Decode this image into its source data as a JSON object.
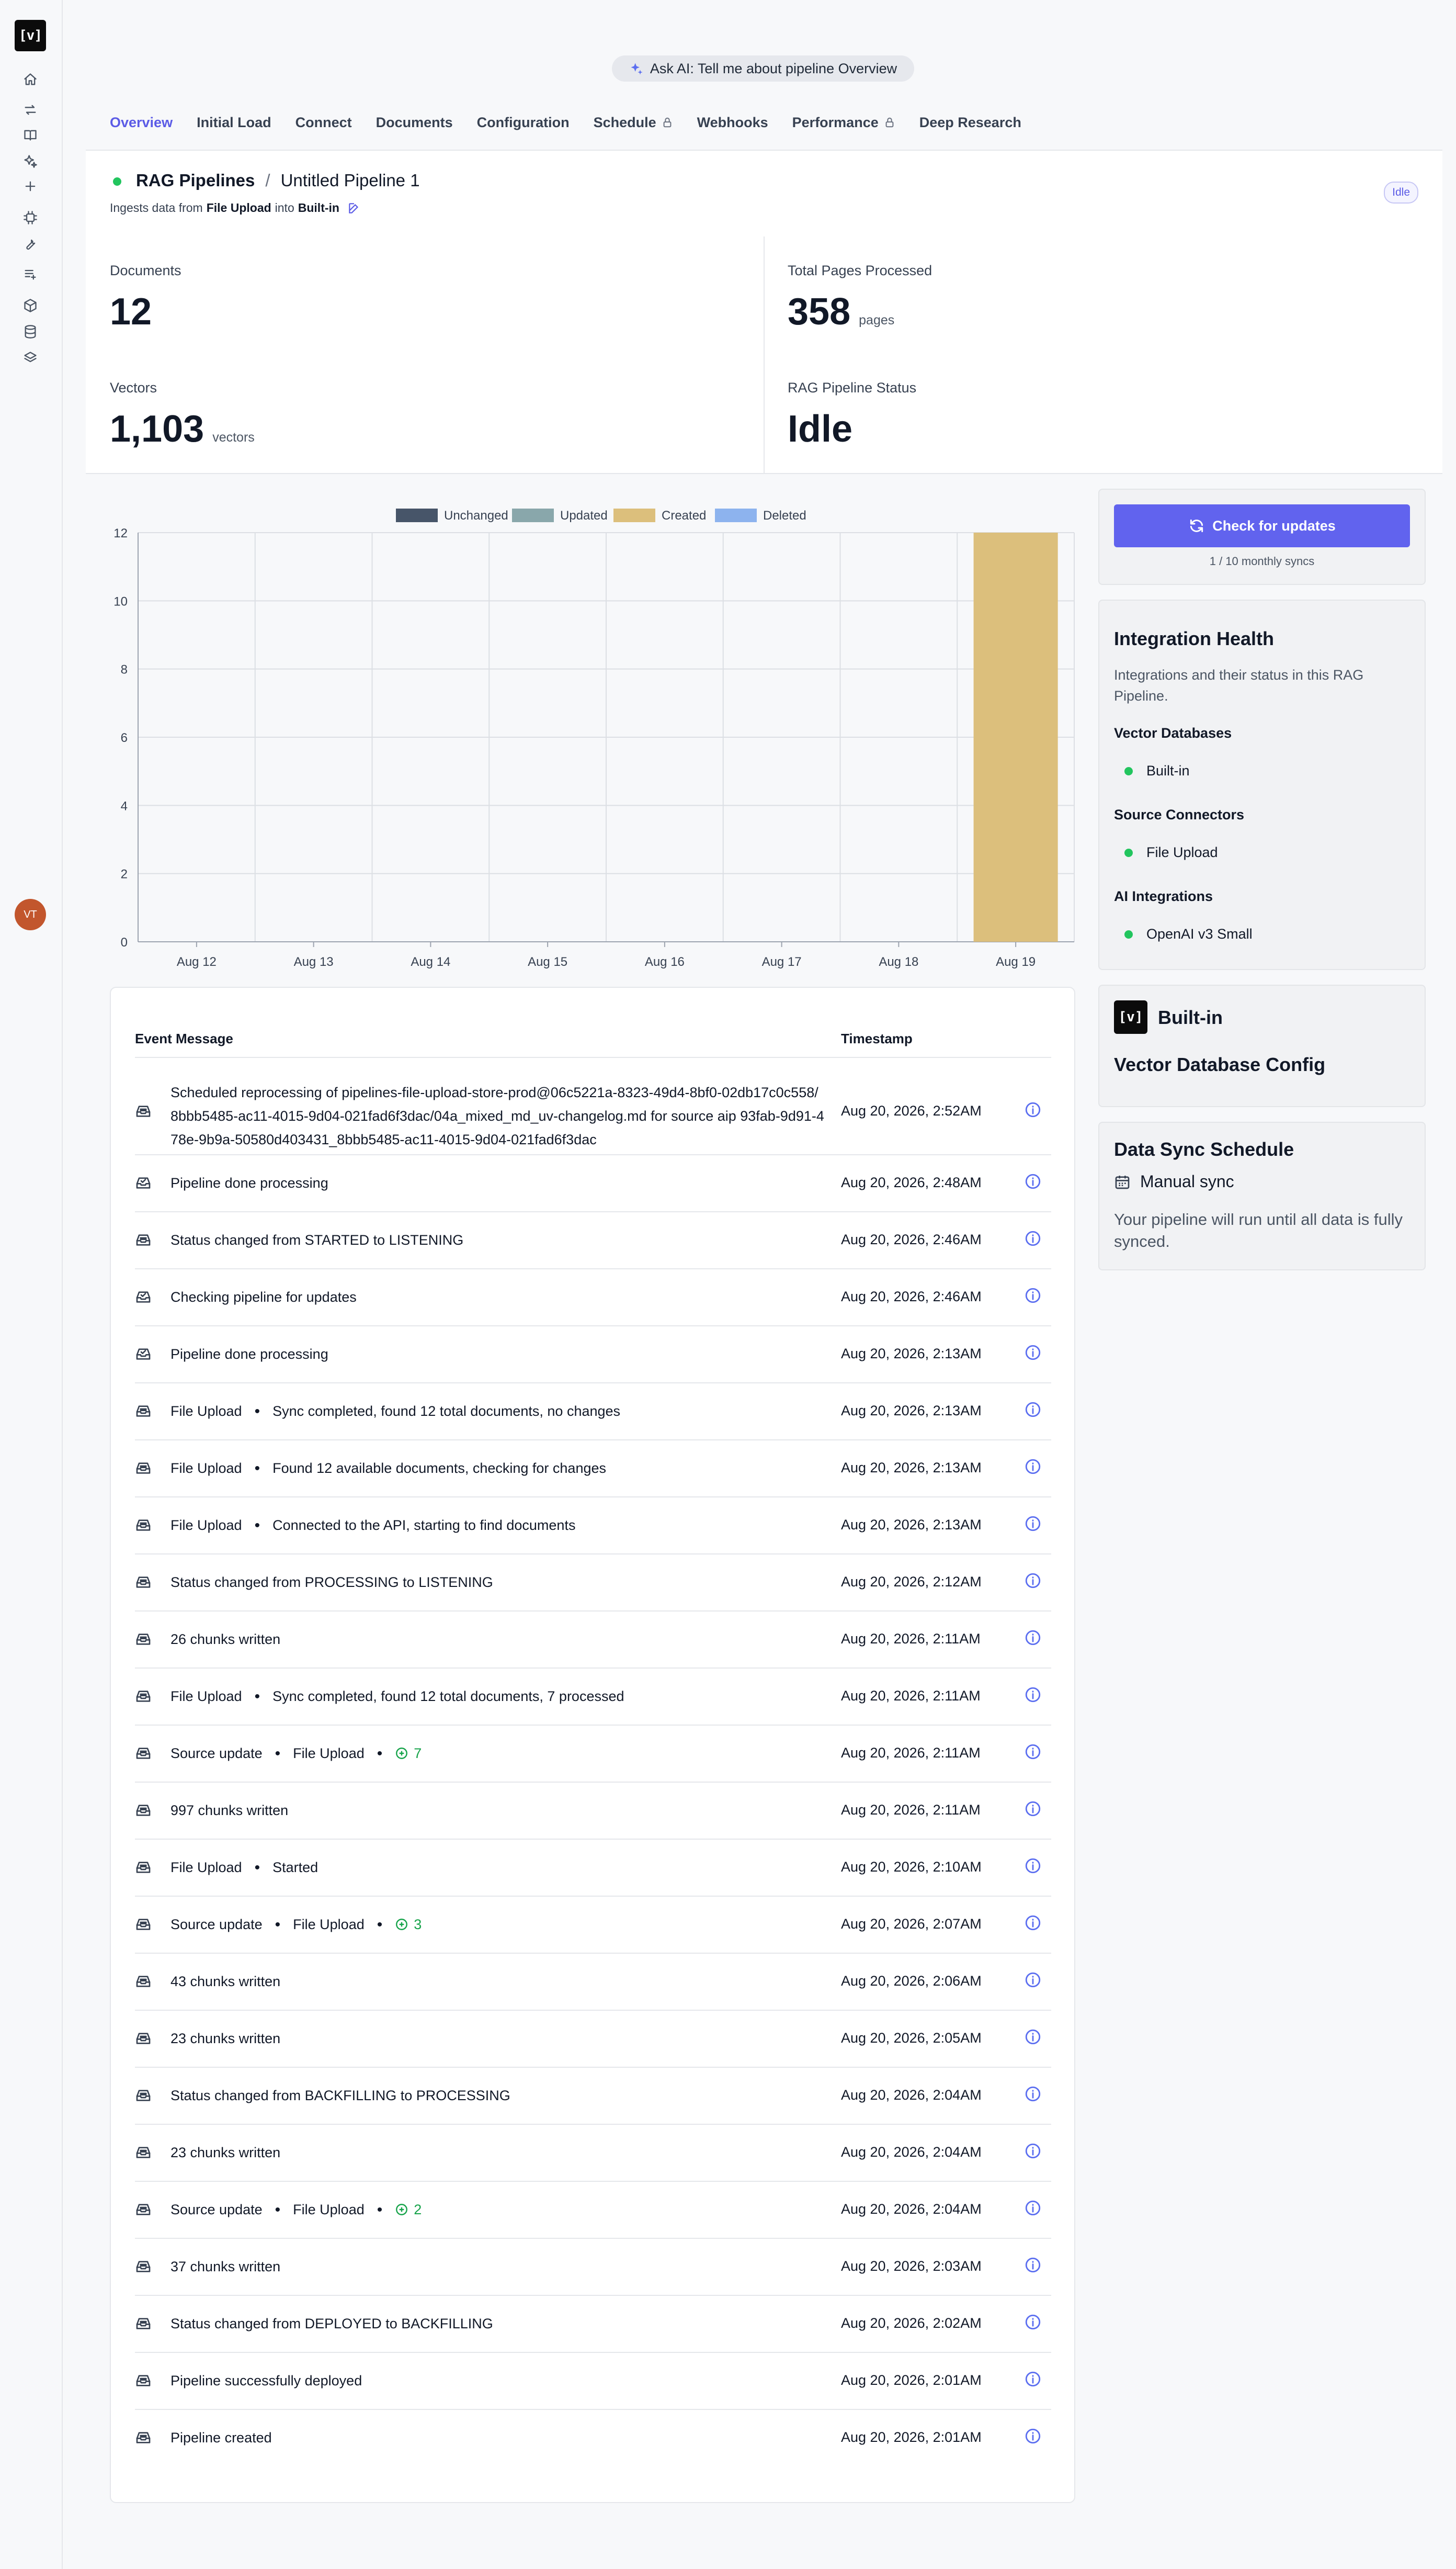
{
  "sidebar": {
    "logo": "[v]",
    "icons": [
      "home-icon",
      "sync-icon",
      "book-icon",
      "sparkles-icon",
      "plus-icon",
      "chip-icon",
      "wrench-icon",
      "list-icon",
      "cube-icon",
      "database-icon",
      "layers-icon"
    ],
    "avatar": "VT"
  },
  "ask_ai": {
    "label": "Ask AI: Tell me about pipeline Overview"
  },
  "tabs": [
    {
      "label": "Overview",
      "active": true,
      "locked": false
    },
    {
      "label": "Initial Load",
      "active": false,
      "locked": false
    },
    {
      "label": "Connect",
      "active": false,
      "locked": false
    },
    {
      "label": "Documents",
      "active": false,
      "locked": false
    },
    {
      "label": "Configuration",
      "active": false,
      "locked": false
    },
    {
      "label": "Schedule",
      "active": false,
      "locked": true
    },
    {
      "label": "Webhooks",
      "active": false,
      "locked": false
    },
    {
      "label": "Performance",
      "active": false,
      "locked": true
    },
    {
      "label": "Deep Research",
      "active": false,
      "locked": false
    }
  ],
  "header": {
    "breadcrumb_root": "RAG Pipelines",
    "separator": "/",
    "pipeline_name": "Untitled Pipeline 1",
    "ingest_prefix": "Ingests data from",
    "source": "File Upload",
    "ingest_middle": "into",
    "destination": "Built-in",
    "status_badge": "Idle"
  },
  "stats": {
    "documents": {
      "label": "Documents",
      "value": "12",
      "unit": ""
    },
    "pages": {
      "label": "Total Pages Processed",
      "value": "358",
      "unit": "pages"
    },
    "vectors": {
      "label": "Vectors",
      "value": "1,103",
      "unit": "vectors"
    },
    "status": {
      "label": "RAG Pipeline Status",
      "value": "Idle",
      "unit": ""
    }
  },
  "chart_data": {
    "type": "bar",
    "stacked": true,
    "categories": [
      "Aug 12",
      "Aug 13",
      "Aug 14",
      "Aug 15",
      "Aug 16",
      "Aug 17",
      "Aug 18",
      "Aug 19"
    ],
    "series": [
      {
        "name": "Unchanged",
        "color": "#475569",
        "values": [
          0,
          0,
          0,
          0,
          0,
          0,
          0,
          0
        ]
      },
      {
        "name": "Updated",
        "color": "#89a7ab",
        "values": [
          0,
          0,
          0,
          0,
          0,
          0,
          0,
          0
        ]
      },
      {
        "name": "Created",
        "color": "#dcbf7c",
        "values": [
          0,
          0,
          0,
          0,
          0,
          0,
          0,
          12
        ]
      },
      {
        "name": "Deleted",
        "color": "#8db3ee",
        "values": [
          0,
          0,
          0,
          0,
          0,
          0,
          0,
          0
        ]
      }
    ],
    "ylim": [
      0,
      12
    ],
    "yticks": [
      0,
      2,
      4,
      6,
      8,
      10,
      12
    ],
    "legend": "top",
    "grid": true
  },
  "events": {
    "header_message": "Event Message",
    "header_timestamp": "Timestamp",
    "rows": [
      {
        "icon": "inbox-icon",
        "parts": [
          "Scheduled reprocessing of pipelines-file-upload-store-prod@06c5221a-8323-49d4-8bf0-02db17c0c558/8bbb5485-ac11-4015-9d04-021fad6f3dac/04a_mixed_md_uv-changelog.md for source aip 93fab-9d91-478e-9b9a-50580d403431_8bbb5485-ac11-4015-9d04-021fad6f3dac"
        ],
        "added": "",
        "ts": "Aug 20, 2026, 2:52AM"
      },
      {
        "icon": "inbox-done-icon",
        "parts": [
          "Pipeline done processing"
        ],
        "added": "",
        "ts": "Aug 20, 2026, 2:48AM"
      },
      {
        "icon": "inbox-icon",
        "parts": [
          "Status changed from STARTED to LISTENING"
        ],
        "added": "",
        "ts": "Aug 20, 2026, 2:46AM"
      },
      {
        "icon": "inbox-done-icon",
        "parts": [
          "Checking pipeline for updates"
        ],
        "added": "",
        "ts": "Aug 20, 2026, 2:46AM"
      },
      {
        "icon": "inbox-done-icon",
        "parts": [
          "Pipeline done processing"
        ],
        "added": "",
        "ts": "Aug 20, 2026, 2:13AM"
      },
      {
        "icon": "inbox-icon",
        "parts": [
          "File Upload",
          "Sync completed, found 12 total documents, no changes"
        ],
        "added": "",
        "ts": "Aug 20, 2026, 2:13AM"
      },
      {
        "icon": "inbox-icon",
        "parts": [
          "File Upload",
          "Found 12 available documents, checking for changes"
        ],
        "added": "",
        "ts": "Aug 20, 2026, 2:13AM"
      },
      {
        "icon": "inbox-icon",
        "parts": [
          "File Upload",
          "Connected to the API, starting to find documents"
        ],
        "added": "",
        "ts": "Aug 20, 2026, 2:13AM"
      },
      {
        "icon": "inbox-icon",
        "parts": [
          "Status changed from PROCESSING to LISTENING"
        ],
        "added": "",
        "ts": "Aug 20, 2026, 2:12AM"
      },
      {
        "icon": "inbox-icon",
        "parts": [
          "26 chunks written"
        ],
        "added": "",
        "ts": "Aug 20, 2026, 2:11AM"
      },
      {
        "icon": "inbox-icon",
        "parts": [
          "File Upload",
          "Sync completed, found 12 total documents, 7 processed"
        ],
        "added": "",
        "ts": "Aug 20, 2026, 2:11AM"
      },
      {
        "icon": "inbox-icon",
        "parts": [
          "Source update",
          "File Upload"
        ],
        "added": "7",
        "ts": "Aug 20, 2026, 2:11AM"
      },
      {
        "icon": "inbox-icon",
        "parts": [
          "997 chunks written"
        ],
        "added": "",
        "ts": "Aug 20, 2026, 2:11AM"
      },
      {
        "icon": "inbox-icon",
        "parts": [
          "File Upload",
          "Started"
        ],
        "added": "",
        "ts": "Aug 20, 2026, 2:10AM"
      },
      {
        "icon": "inbox-icon",
        "parts": [
          "Source update",
          "File Upload"
        ],
        "added": "3",
        "ts": "Aug 20, 2026, 2:07AM"
      },
      {
        "icon": "inbox-icon",
        "parts": [
          "43 chunks written"
        ],
        "added": "",
        "ts": "Aug 20, 2026, 2:06AM"
      },
      {
        "icon": "inbox-icon",
        "parts": [
          "23 chunks written"
        ],
        "added": "",
        "ts": "Aug 20, 2026, 2:05AM"
      },
      {
        "icon": "inbox-icon",
        "parts": [
          "Status changed from BACKFILLING to PROCESSING"
        ],
        "added": "",
        "ts": "Aug 20, 2026, 2:04AM"
      },
      {
        "icon": "inbox-icon",
        "parts": [
          "23 chunks written"
        ],
        "added": "",
        "ts": "Aug 20, 2026, 2:04AM"
      },
      {
        "icon": "inbox-icon",
        "parts": [
          "Source update",
          "File Upload"
        ],
        "added": "2",
        "ts": "Aug 20, 2026, 2:04AM"
      },
      {
        "icon": "inbox-icon",
        "parts": [
          "37 chunks written"
        ],
        "added": "",
        "ts": "Aug 20, 2026, 2:03AM"
      },
      {
        "icon": "inbox-icon",
        "parts": [
          "Status changed from DEPLOYED to BACKFILLING"
        ],
        "added": "",
        "ts": "Aug 20, 2026, 2:02AM"
      },
      {
        "icon": "inbox-icon",
        "parts": [
          "Pipeline successfully deployed"
        ],
        "added": "",
        "ts": "Aug 20, 2026, 2:01AM"
      },
      {
        "icon": "inbox-icon",
        "parts": [
          "Pipeline created"
        ],
        "added": "",
        "ts": "Aug 20, 2026, 2:01AM"
      }
    ]
  },
  "sync_panel": {
    "button_label": "Check for updates",
    "count_text": "1 / 10 monthly syncs"
  },
  "integration_health": {
    "title": "Integration Health",
    "description": "Integrations and their status in this RAG Pipeline.",
    "groups": [
      {
        "title": "Vector Databases",
        "item": "Built-in"
      },
      {
        "title": "Source Connectors",
        "item": "File Upload"
      },
      {
        "title": "AI Integrations",
        "item": "OpenAI v3 Small"
      }
    ]
  },
  "vector_db": {
    "logo": "[v]",
    "name": "Built-in",
    "config_title": "Vector Database Config"
  },
  "data_sync": {
    "title": "Data Sync Schedule",
    "mode": "Manual sync",
    "description": "Your pipeline will run until all data is fully synced."
  }
}
